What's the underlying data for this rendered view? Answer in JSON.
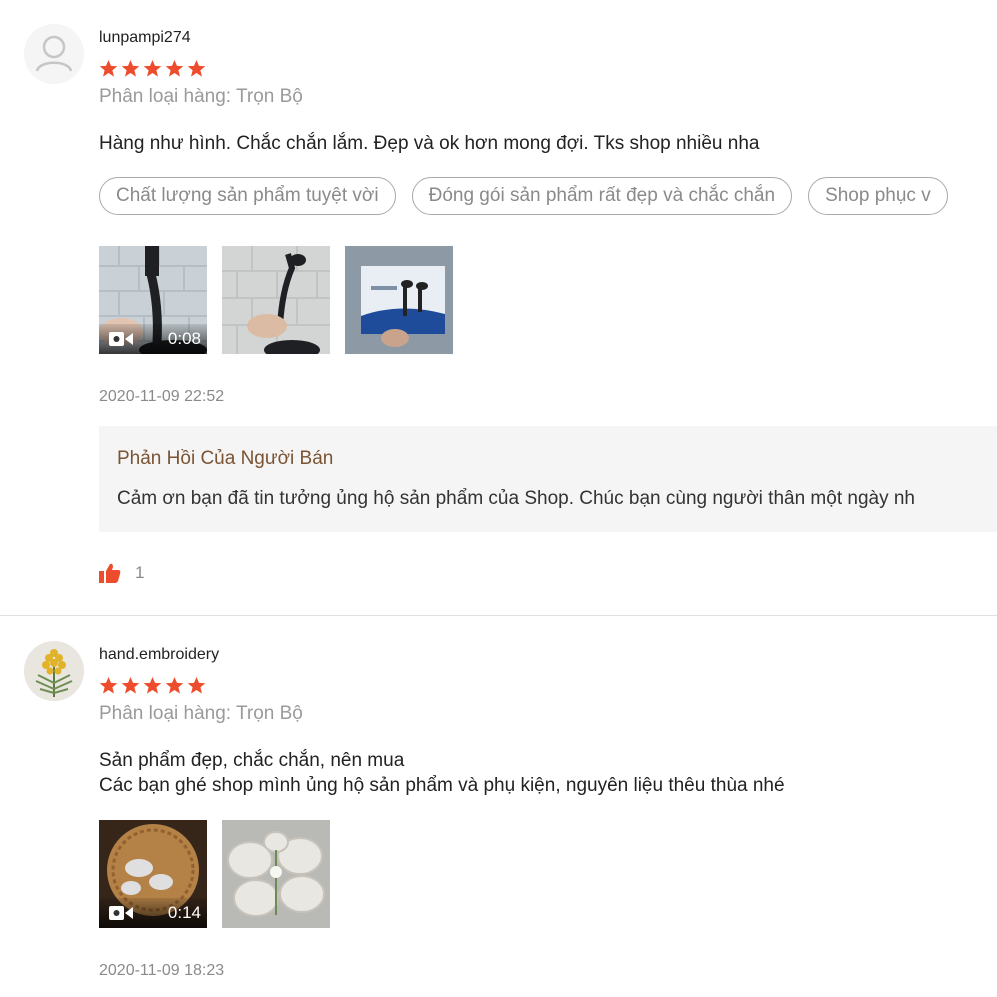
{
  "reviews": [
    {
      "username": "lunpampi274",
      "rating": 5,
      "variation": "Phân loại hàng: Trọn Bộ",
      "comment_lines": [
        "Hàng như hình. Chắc chắn lắm. Đẹp và ok hơn mong đợi. Tks shop nhiều nha"
      ],
      "tags": [
        "Chất lượng sản phẩm tuyệt vời",
        "Đóng gói sản phẩm rất đẹp và chắc chắn",
        "Shop phục v"
      ],
      "video_duration": "0:08",
      "timestamp": "2020-11-09 22:52",
      "reply": {
        "title": "Phản Hồi Của Người Bán",
        "text": "Cảm ơn bạn đã tin tưởng ủng hộ sản phẩm của Shop. Chúc bạn cùng người thân một ngày nh"
      },
      "likes": "1"
    },
    {
      "username": "hand.embroidery",
      "rating": 5,
      "variation": "Phân loại hàng: Trọn Bộ",
      "comment_lines": [
        "Sản phẩm đẹp, chắc chắn, nên mua",
        "Các bạn ghé shop mình ủng hộ sản phẩm và phụ kiện, nguyên liệu thêu thùa nhé"
      ],
      "video_duration": "0:14",
      "timestamp": "2020-11-09 18:23"
    }
  ],
  "colors": {
    "star": "#ee4d2d",
    "like": "#ee4d2d",
    "reply_title": "#7a5433",
    "muted": "#8a8a8a"
  },
  "icons": {
    "avatar_placeholder": "user-icon",
    "star": "star-icon",
    "video": "video-camera-icon",
    "like": "thumbs-up-icon"
  }
}
